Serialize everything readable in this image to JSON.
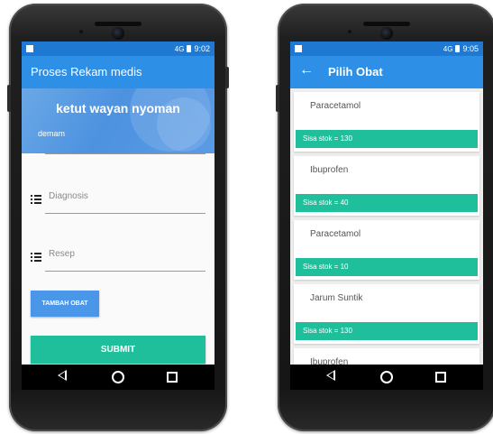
{
  "left": {
    "status_time": "9:02",
    "signal": "4G",
    "app_title": "Proses Rekam medis",
    "patient_name": "ketut wayan nyoman",
    "complaint": "demam",
    "diagnosis_placeholder": "Diagnosis",
    "resep_placeholder": "Resep",
    "tambah_obat_label": "TAMBAH OBAT",
    "submit_label": "SUBMIT"
  },
  "right": {
    "status_time": "9:05",
    "signal": "4G",
    "app_title": "Pilih Obat",
    "items": [
      {
        "name": "Paracetamol",
        "stock": "Sisa stok = 130"
      },
      {
        "name": "Ibuprofen",
        "stock": "Sisa stok = 40"
      },
      {
        "name": "Paracetamol",
        "stock": "Sisa stok = 10"
      },
      {
        "name": "Jarum Suntik",
        "stock": "Sisa stok = 130"
      },
      {
        "name": "Ibuprofen"
      }
    ]
  },
  "colors": {
    "status_bar": "#1f78d1",
    "app_bar": "#2e8fe6",
    "accent_green": "#1fbf9c",
    "button_blue": "#4a97ea"
  },
  "icons": [
    "back-arrow-icon",
    "list-icon",
    "nav-back-icon",
    "nav-home-icon",
    "nav-recent-icon",
    "battery-icon",
    "signal-icon"
  ]
}
